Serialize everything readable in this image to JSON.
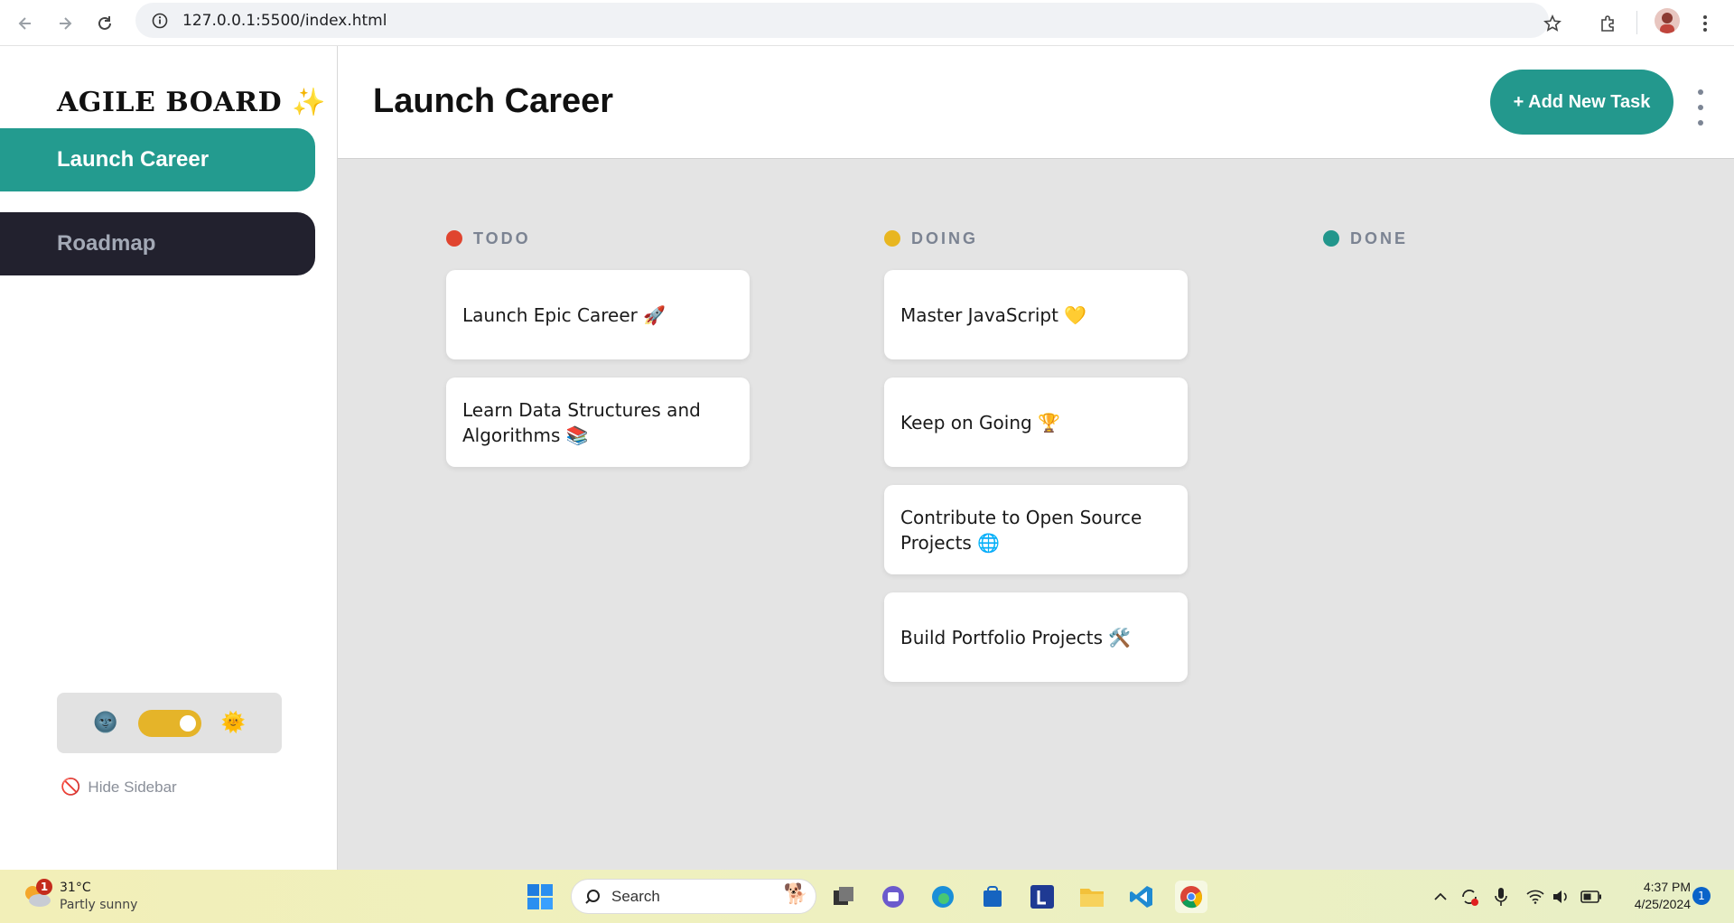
{
  "browser": {
    "url": "127.0.0.1:5500/index.html"
  },
  "sidebar": {
    "logo": "AGILE BOARD",
    "logo_emoji": "✨",
    "boards": [
      {
        "label": "Launch Career",
        "active": true
      },
      {
        "label": "Roadmap",
        "active": false
      }
    ],
    "theme": {
      "moon": "🌚",
      "sun": "🌞",
      "light_mode": true
    },
    "hide_icon": "🚫",
    "hide_label": "Hide Sidebar"
  },
  "header": {
    "title": "Launch Career",
    "add_task_label": "+ Add New Task"
  },
  "columns": [
    {
      "title": "TODO",
      "color": "#e0442f",
      "tasks": [
        "Launch Epic Career 🚀",
        "Learn Data Structures and Algorithms 📚"
      ]
    },
    {
      "title": "DOING",
      "color": "#e8b620",
      "tasks": [
        "Master JavaScript 💛",
        "Keep on Going 🏆",
        "Contribute to Open Source Projects 🌐",
        "Build Portfolio Projects 🛠️"
      ]
    },
    {
      "title": "DONE",
      "color": "#22968c",
      "tasks": []
    }
  ],
  "taskbar": {
    "weather_badge": "1",
    "temperature": "31°C",
    "condition": "Partly sunny",
    "search_label": "Search",
    "time": "4:37 PM",
    "date": "4/25/2024",
    "notifications": "1"
  },
  "colors": {
    "accent": "#239b8f",
    "sidebar_dark_item": "#22212e",
    "board_bg": "#e4e4e4",
    "toggle": "#e5b429"
  }
}
